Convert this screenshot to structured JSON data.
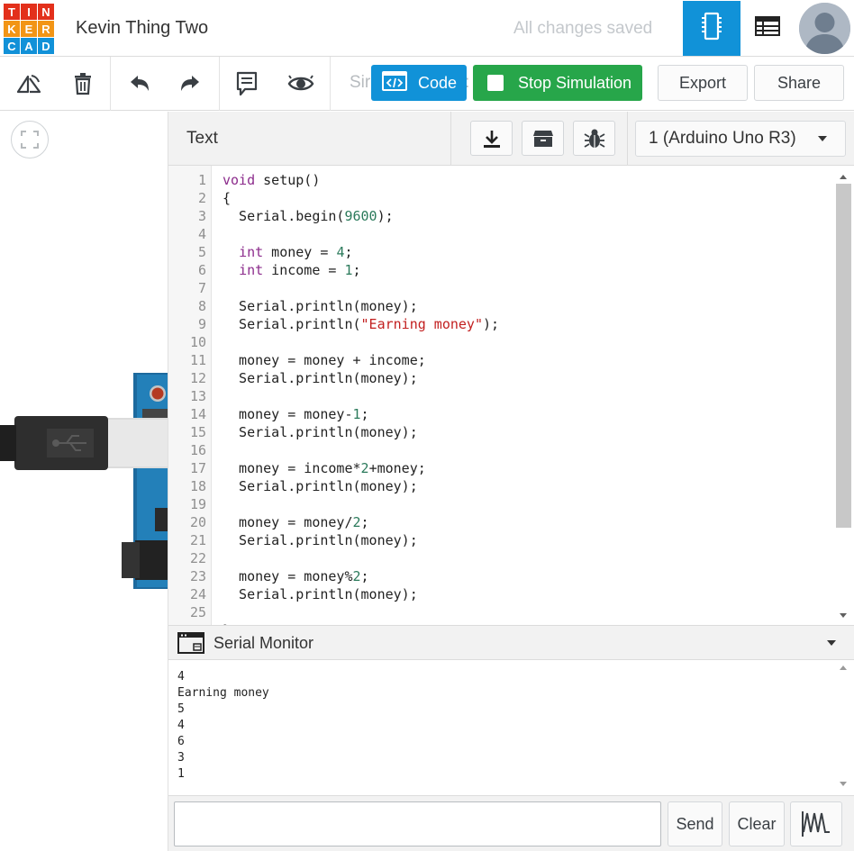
{
  "app": {
    "logo_letters": [
      "T",
      "I",
      "N",
      "K",
      "E",
      "R",
      "C",
      "A",
      "D"
    ],
    "logo_colors": [
      "#e3301b",
      "#e3301b",
      "#e3301b",
      "#f29516",
      "#f29516",
      "#f29516",
      "#1191d8",
      "#1191d8",
      "#1191d8"
    ],
    "project_title": "Kevin Thing Two",
    "save_status": "All changes saved",
    "views": [
      "circuit-view-icon",
      "schematic-view-icon"
    ],
    "avatar": "user-avatar-icon"
  },
  "toolbar": {
    "icons": [
      "rotate-icon",
      "delete-icon",
      "undo-icon",
      "redo-icon",
      "notes-icon",
      "visibility-icon"
    ],
    "sim_label_partial": "Sir",
    "sim_label_tail": ":",
    "code_label": "Code",
    "stop_label": "Stop Simulation",
    "export_label": "Export",
    "share_label": "Share",
    "accent": "#1192d8",
    "sim_color": "#27a64a"
  },
  "canvas": {
    "fit_icon": "fit-view-icon"
  },
  "code_panel": {
    "mode": "Text",
    "icons": [
      "download-icon",
      "library-icon",
      "debug-icon"
    ],
    "device": "1 (Arduino Uno R3)",
    "lines": [
      [
        [
          "kw",
          "void"
        ],
        [
          "p",
          " setup()"
        ]
      ],
      [
        [
          "p",
          "{"
        ]
      ],
      [
        [
          "p",
          "  Serial.begin("
        ],
        [
          "num",
          "9600"
        ],
        [
          "p",
          ");"
        ]
      ],
      [],
      [
        [
          "p",
          "  "
        ],
        [
          "kw",
          "int"
        ],
        [
          "p",
          " money = "
        ],
        [
          "num",
          "4"
        ],
        [
          "p",
          ";"
        ]
      ],
      [
        [
          "p",
          "  "
        ],
        [
          "kw",
          "int"
        ],
        [
          "p",
          " income = "
        ],
        [
          "num",
          "1"
        ],
        [
          "p",
          ";"
        ]
      ],
      [],
      [
        [
          "p",
          "  Serial.println(money);"
        ]
      ],
      [
        [
          "p",
          "  Serial.println("
        ],
        [
          "str",
          "\"Earning money\""
        ],
        [
          "p",
          ");"
        ]
      ],
      [],
      [
        [
          "p",
          "  money = money + income;"
        ]
      ],
      [
        [
          "p",
          "  Serial.println(money);"
        ]
      ],
      [],
      [
        [
          "p",
          "  money = money-"
        ],
        [
          "num",
          "1"
        ],
        [
          "p",
          ";"
        ]
      ],
      [
        [
          "p",
          "  Serial.println(money);"
        ]
      ],
      [],
      [
        [
          "p",
          "  money = income*"
        ],
        [
          "num",
          "2"
        ],
        [
          "p",
          "+money;"
        ]
      ],
      [
        [
          "p",
          "  Serial.println(money);"
        ]
      ],
      [],
      [
        [
          "p",
          "  money = money/"
        ],
        [
          "num",
          "2"
        ],
        [
          "p",
          ";"
        ]
      ],
      [
        [
          "p",
          "  Serial.println(money);"
        ]
      ],
      [],
      [
        [
          "p",
          "  money = money%"
        ],
        [
          "num",
          "2"
        ],
        [
          "p",
          ";"
        ]
      ],
      [
        [
          "p",
          "  Serial.println(money);"
        ]
      ],
      [],
      [
        [
          "p",
          "}"
        ]
      ]
    ]
  },
  "serial_monitor": {
    "title": "Serial Monitor",
    "output": [
      "4",
      "Earning money",
      "5",
      "4",
      "6",
      "3",
      "1"
    ],
    "input_value": "",
    "send_label": "Send",
    "clear_label": "Clear",
    "graph_icon": "graph-icon"
  }
}
